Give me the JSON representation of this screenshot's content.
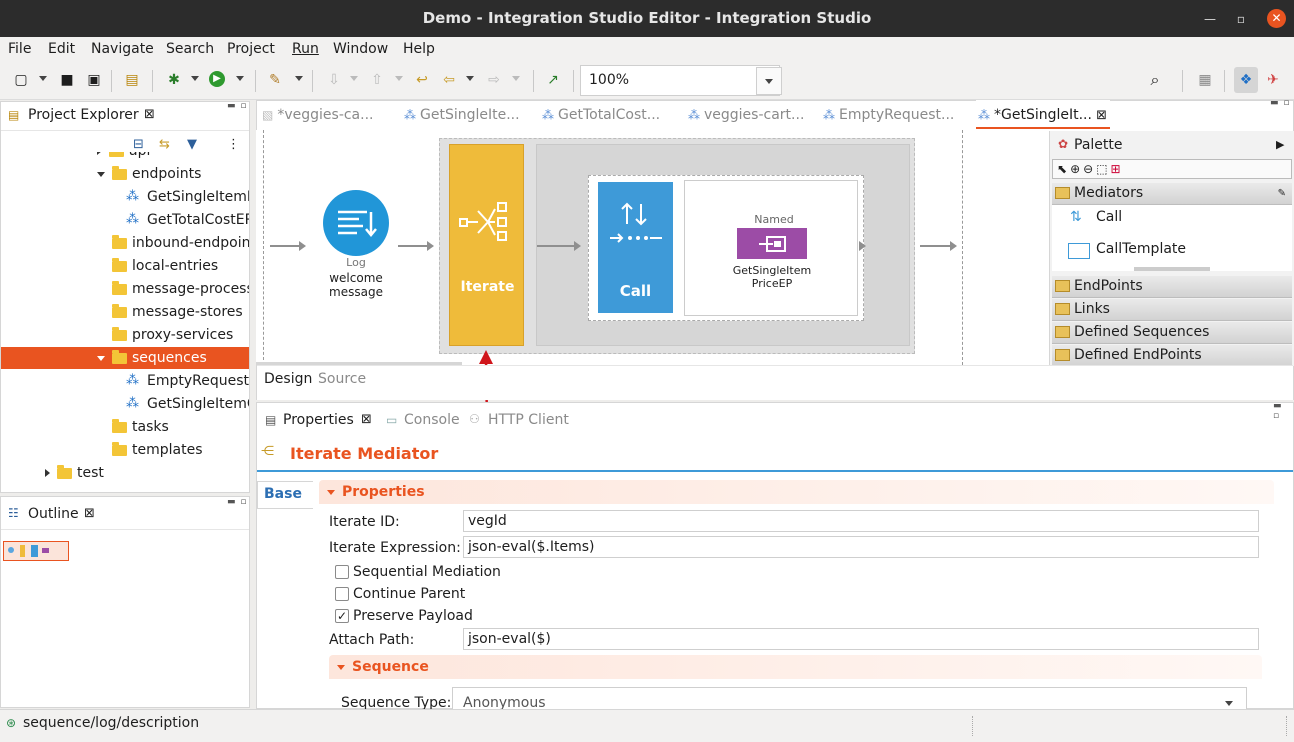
{
  "window": {
    "title": "Demo - Integration Studio Editor - Integration Studio"
  },
  "menu": [
    "File",
    "Edit",
    "Navigate",
    "Search",
    "Project",
    "Run",
    "Window",
    "Help"
  ],
  "toolbar": {
    "zoom": "100%"
  },
  "project_explorer": {
    "title": "Project Explorer",
    "items": [
      {
        "label": "api",
        "indent": 1,
        "type": "folder",
        "toggle": "right"
      },
      {
        "label": "endpoints",
        "indent": 1,
        "type": "folder",
        "toggle": "down"
      },
      {
        "label": "GetSingleItemPriceEP",
        "indent": 2,
        "type": "ep"
      },
      {
        "label": "GetTotalCostEP",
        "indent": 2,
        "type": "ep"
      },
      {
        "label": "inbound-endpoints",
        "indent": 1,
        "type": "folder"
      },
      {
        "label": "local-entries",
        "indent": 1,
        "type": "folder"
      },
      {
        "label": "message-processors",
        "indent": 1,
        "type": "folder"
      },
      {
        "label": "message-stores",
        "indent": 1,
        "type": "folder"
      },
      {
        "label": "proxy-services",
        "indent": 1,
        "type": "folder"
      },
      {
        "label": "sequences",
        "indent": 1,
        "type": "folder",
        "toggle": "down",
        "selected": true
      },
      {
        "label": "EmptyRequestSequence",
        "indent": 2,
        "type": "ep"
      },
      {
        "label": "GetSingleItemCostSequence",
        "indent": 2,
        "type": "ep"
      },
      {
        "label": "tasks",
        "indent": 1,
        "type": "folder"
      },
      {
        "label": "templates",
        "indent": 1,
        "type": "folder"
      },
      {
        "label": "test",
        "indent": 0,
        "type": "folder",
        "toggle": "right"
      }
    ]
  },
  "outline": {
    "title": "Outline"
  },
  "editor_tabs": [
    {
      "label": "*veggies-ca...",
      "active": false
    },
    {
      "label": "GetSingleIte...",
      "active": false
    },
    {
      "label": "GetTotalCost...",
      "active": false
    },
    {
      "label": "veggies-cart...",
      "active": false
    },
    {
      "label": "EmptyRequest...",
      "active": false
    },
    {
      "label": "*GetSingleIt...",
      "active": true
    }
  ],
  "diagram": {
    "log_small": "Log",
    "log_desc": "welcome message",
    "iterate_label": "Iterate",
    "call_label": "Call",
    "named_label": "Named",
    "ep_label": "GetSingleItem PriceEP"
  },
  "palette": {
    "title": "Palette",
    "mediators_group": "Mediators",
    "items": [
      "Call",
      "CallTemplate"
    ],
    "groups": [
      "EndPoints",
      "Links",
      "Defined Sequences",
      "Defined EndPoints"
    ]
  },
  "editor_bottom_tabs": {
    "design": "Design",
    "source": "Source"
  },
  "bottom_tabs": {
    "properties": "Properties",
    "console": "Console",
    "http": "HTTP Client"
  },
  "properties": {
    "header": "Iterate Mediator",
    "side_tab": "Base",
    "section": "Properties",
    "iterate_id_label": "Iterate ID:",
    "iterate_id": "vegId",
    "iterate_expr_label": "Iterate Expression:",
    "iterate_expr": "json-eval($.Items)",
    "sequential": {
      "label": "Sequential Mediation",
      "checked": false
    },
    "continue_parent": {
      "label": "Continue Parent",
      "checked": false
    },
    "preserve_payload": {
      "label": "Preserve Payload",
      "checked": true
    },
    "attach_path_label": "Attach Path:",
    "attach_path": "json-eval($)",
    "sequence_section": "Sequence",
    "sequence_type_label": "Sequence Type:",
    "sequence_type": "Anonymous"
  },
  "status": {
    "text": "sequence/log/description"
  },
  "colors": {
    "accent": "#e95420",
    "iterate": "#efbb3a",
    "call": "#3e9ad8",
    "endpoint": "#9c4ca6",
    "selection": "#e95420"
  }
}
